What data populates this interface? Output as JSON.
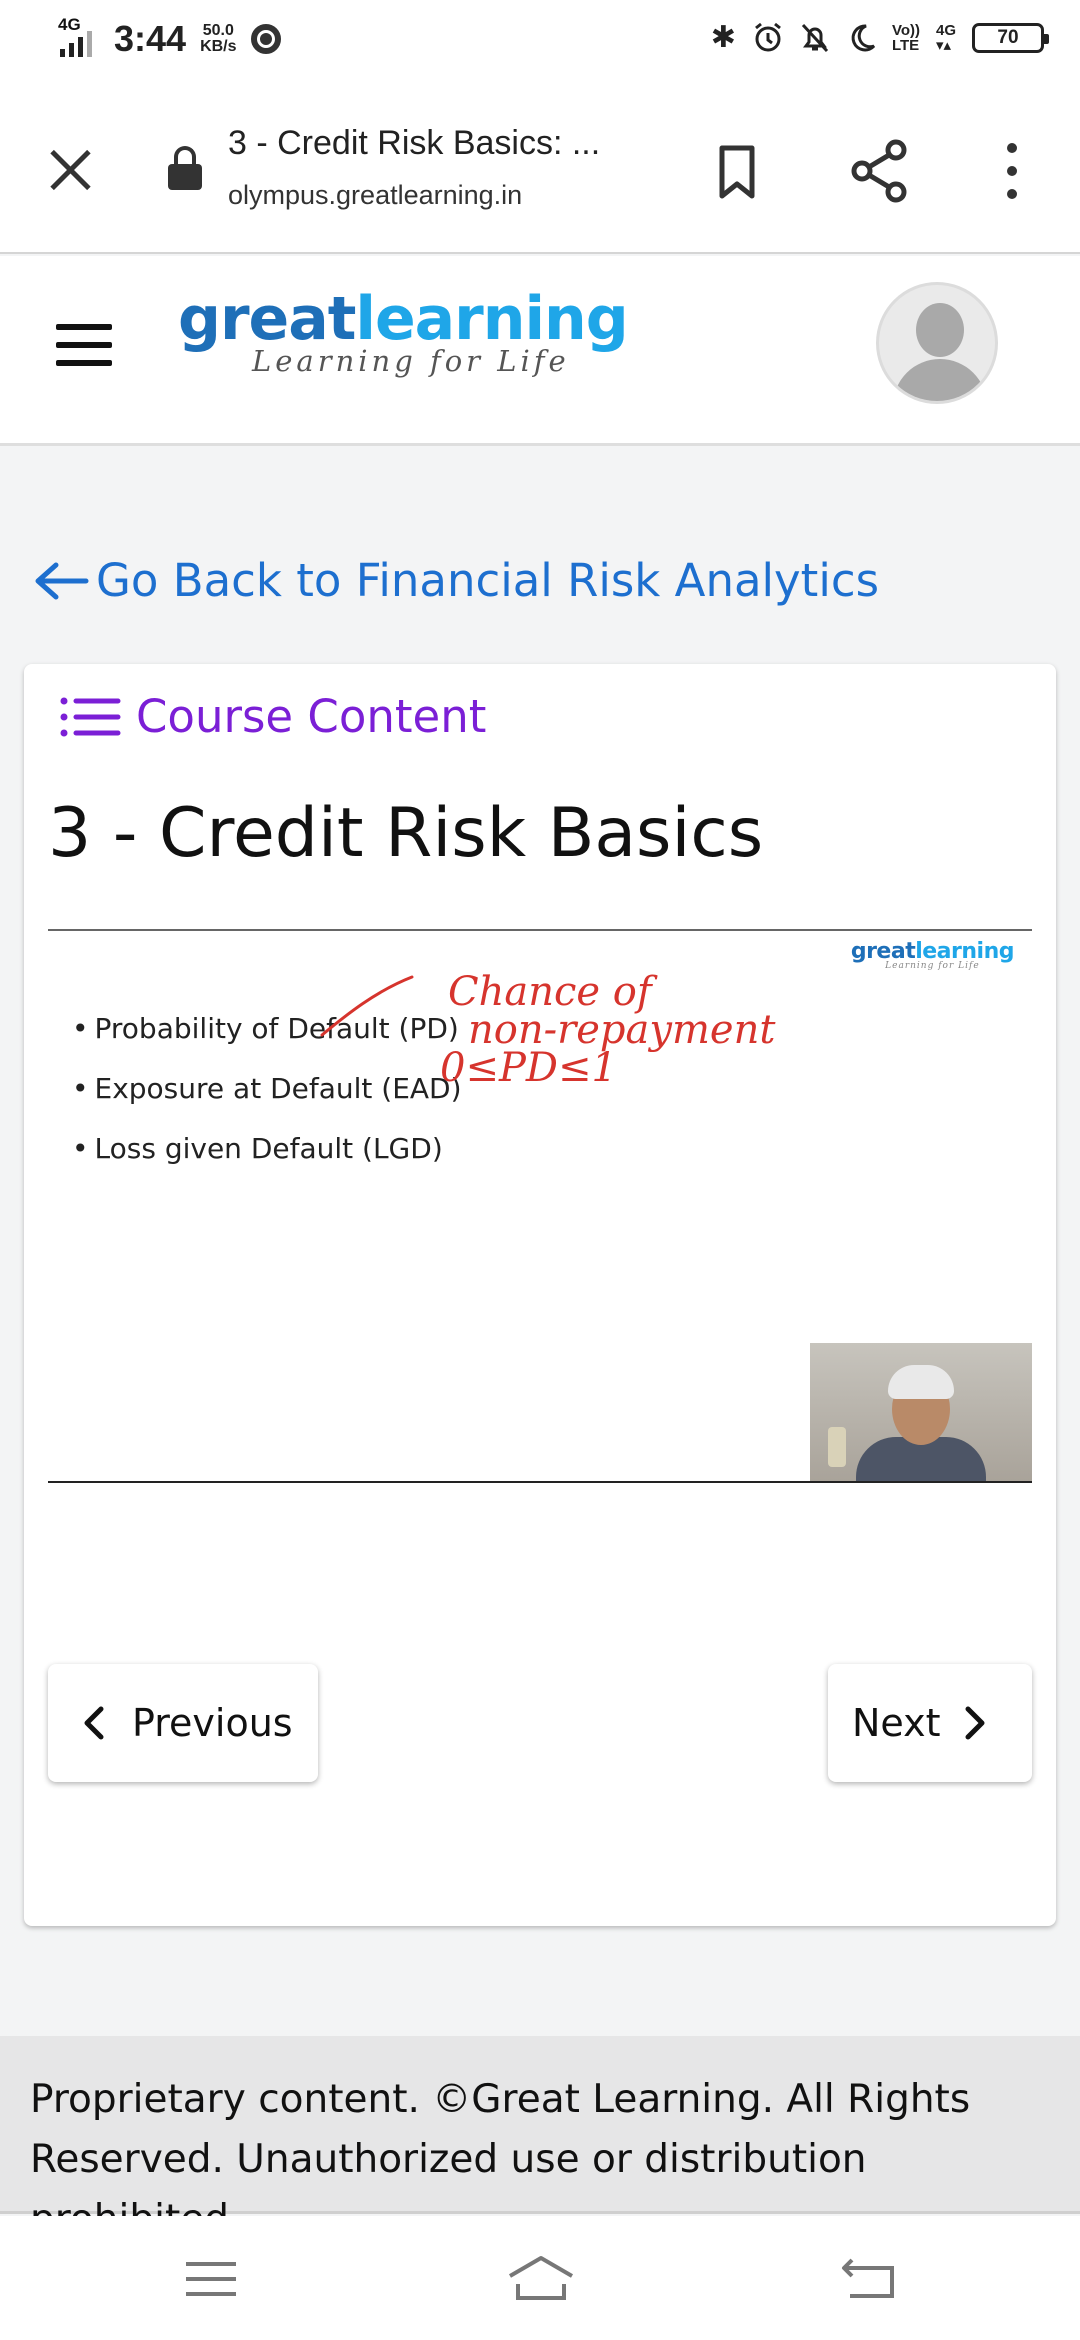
{
  "status_bar": {
    "network_tag": "4G",
    "time": "3:44",
    "speed_value": "50.0",
    "speed_unit": "KB/s",
    "volte": "Vo))",
    "lte": "LTE",
    "net_4g": "4G",
    "battery": "70",
    "icons": [
      "chrome-icon",
      "bluetooth-icon",
      "alarm-icon",
      "notifications-off-icon",
      "do-not-disturb-moon-icon"
    ]
  },
  "browser": {
    "page_title": "3 - Credit Risk Basics: ...",
    "url": "olympus.greatlearning.in",
    "icons": [
      "close-icon",
      "lock-icon",
      "bookmark-icon",
      "share-icon",
      "more-vert-icon"
    ]
  },
  "site_header": {
    "logo_great": "great",
    "logo_learning": "learning",
    "logo_tagline": "Learning for Life",
    "icons": [
      "hamburger-icon",
      "avatar"
    ]
  },
  "back_link": {
    "label": "Go Back to Financial Risk Analytics",
    "icon": "arrow-left-icon",
    "color": "#1d6fcf"
  },
  "course": {
    "content_label": "Course Content",
    "content_icon": "list-icon",
    "content_color": "#7b1fd6",
    "title": "3 - Credit Risk Basics"
  },
  "slide": {
    "logo_great": "great",
    "logo_learning": "learning",
    "logo_tagline": "Learning for Life",
    "bullets": [
      "Probability of Default (PD)",
      "Exposure at Default (EAD)",
      "Loss given Default (LGD)"
    ],
    "annotation": {
      "line1": "Chance of",
      "line2": "non-repayment",
      "line3": "0≤PD≤1",
      "color": "#d6342d"
    }
  },
  "navigation": {
    "previous_label": "Previous",
    "next_label": "Next"
  },
  "footer": {
    "text": "Proprietary content. ©Great Learning. All Rights Reserved. Unauthorized use or distribution prohibited."
  },
  "system_nav": {
    "icons": [
      "menu-icon",
      "home-icon",
      "back-icon"
    ]
  }
}
